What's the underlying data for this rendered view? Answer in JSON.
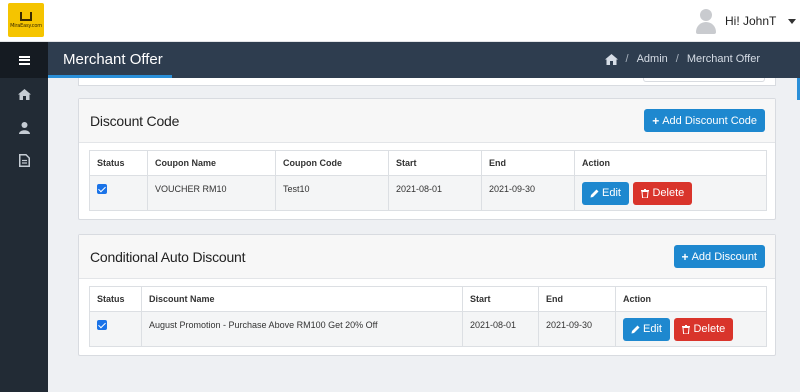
{
  "header": {
    "logo_text": "MiraEasy.com",
    "user_greeting": "Hi! JohnT"
  },
  "titlebar": {
    "title": "Merchant Offer",
    "breadcrumb": [
      "Admin",
      "Merchant Offer"
    ]
  },
  "sidebar": {
    "items": [
      {
        "icon": "home-icon"
      },
      {
        "icon": "user-icon"
      },
      {
        "icon": "document-icon"
      }
    ]
  },
  "discount_code": {
    "title": "Discount Code",
    "add_label": "Add Discount Code",
    "columns": [
      "Status",
      "Coupon Name",
      "Coupon Code",
      "Start",
      "End",
      "Action"
    ],
    "rows": [
      {
        "checked": true,
        "coupon_name": "VOUCHER RM10",
        "coupon_code": "Test10",
        "start": "2021-08-01",
        "end": "2021-09-30"
      }
    ],
    "edit_label": "Edit",
    "delete_label": "Delete"
  },
  "conditional": {
    "title": "Conditional Auto Discount",
    "add_label": "Add Discount",
    "columns": [
      "Status",
      "Discount Name",
      "Start",
      "End",
      "Action"
    ],
    "rows": [
      {
        "checked": true,
        "discount_name": "August Promotion - Purchase Above RM100 Get 20% Off",
        "start": "2021-08-01",
        "end": "2021-09-30"
      }
    ],
    "edit_label": "Edit",
    "delete_label": "Delete"
  },
  "colors": {
    "primary": "#1e88cf",
    "danger": "#d9342b",
    "titlebar": "#2e3d4f",
    "sidebar": "#222b35",
    "logo": "#f5c400"
  }
}
